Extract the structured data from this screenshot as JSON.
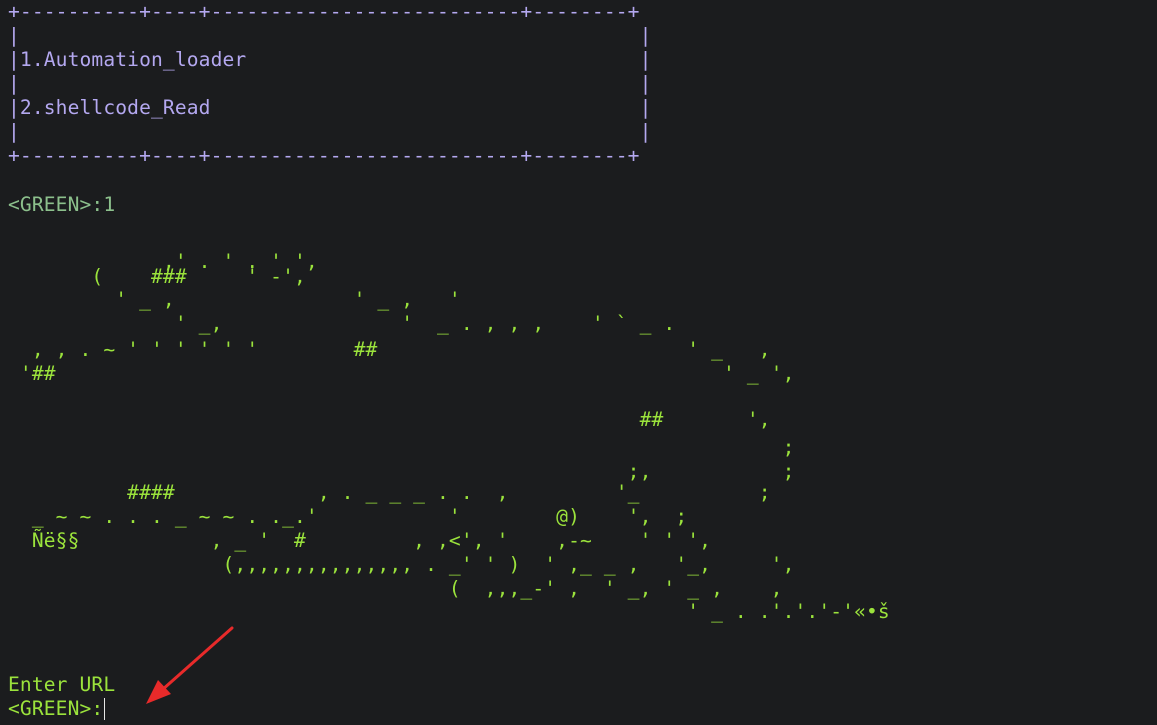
{
  "menu": {
    "border_top": "+----------+----+--------------------------+--------+",
    "blank_1": "|                                                    |",
    "item_1": "|1.Automation_loader                                 |",
    "blank_2": "|                                                    |",
    "item_2": "|2.shellcode_Read                                    |",
    "blank_3": "|                                                    |",
    "border_bottom": "+----------+----+--------------------------+--------+"
  },
  "prompt_1": "<GREEN>:1",
  "ascii_art": [
    "             ,' . ' . ' ',",
    "       (    ###     ' -',",
    "         ' _ ,               ' _ ,   '",
    "              ' _,               '  _ . , , ,    ' ` _ .",
    "  , , . ~ ' ' ' ' ' '        ##                          ' _   ,",
    " '##                                                        ' _ ',",
    "                                                     ##       ',",
    "                                                                 ;",
    "                                                    ;,           ;",
    "          ####            , . _ _ _ . .  ,         '_          ;",
    "  _ ~ ~ . . . _ ~ ~ . ._.'           '        @)    ',  ;",
    "  Ñë§§           , _ '  #         , ,<', '    ,-~    ' ' ',",
    "                  (,,,,,,,,,,,,,,, . _' ' )  ' ,_ _ ,   '_,     ',",
    "                                     (  ,,,_-' ,  ' _, ' _ ,    ,",
    "                                                         ' _ . .'.'.'-'«•š"
  ],
  "enter_label": "Enter URL",
  "prompt_2": "<GREEN>:",
  "colors": {
    "background": "#1b1c1e",
    "menu": "#b4a8f0",
    "prompt": "#8cc08c",
    "art": "#9be33c",
    "annotation_arrow": "#e82a2a"
  },
  "icons": [
    "red-arrow-annotation",
    "text-cursor"
  ]
}
